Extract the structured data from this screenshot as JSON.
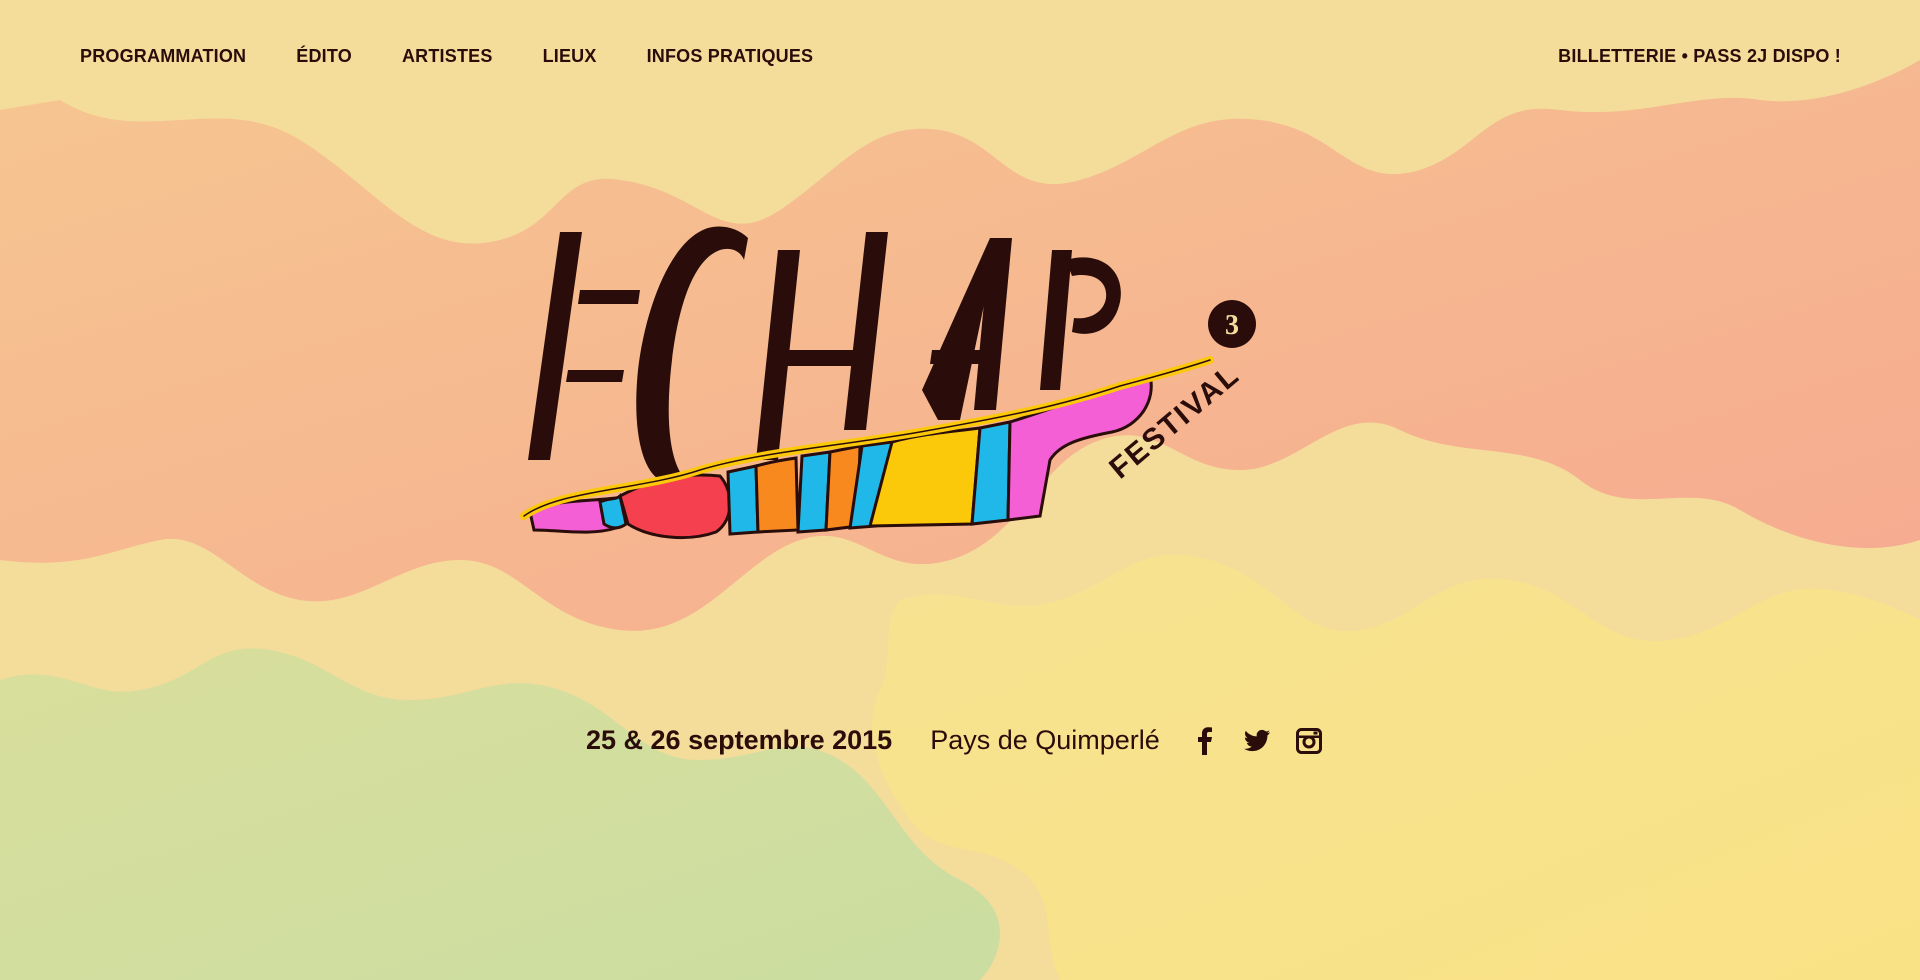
{
  "nav": {
    "items": [
      {
        "label": "PROGRAMMATION"
      },
      {
        "label": "ÉDITO"
      },
      {
        "label": "ARTISTES"
      },
      {
        "label": "LIEUX"
      },
      {
        "label": "INFOS PRATIQUES"
      }
    ],
    "ticket_label": "BILLETTERIE • PASS 2J DISPO !"
  },
  "logo": {
    "name": "ECHAP",
    "subtitle": "FESTIVAL",
    "edition": "3"
  },
  "event": {
    "dates": "25 & 26 septembre 2015",
    "place": "Pays de Quimperlé"
  },
  "socials": [
    {
      "icon": "facebook-icon"
    },
    {
      "icon": "twitter-icon"
    },
    {
      "icon": "instagram-icon"
    }
  ],
  "colors": {
    "background": "#f4dc9a",
    "text": "#2a0d0a",
    "orange_cloud": "#f6a98a",
    "green_cloud": "#cfe0a0",
    "yellow_cloud": "#f8e08a",
    "pink": "#f45fd6",
    "red": "#f5404f",
    "blue": "#1fb8e8",
    "orange": "#f7891f",
    "yellow": "#fbc90a"
  }
}
